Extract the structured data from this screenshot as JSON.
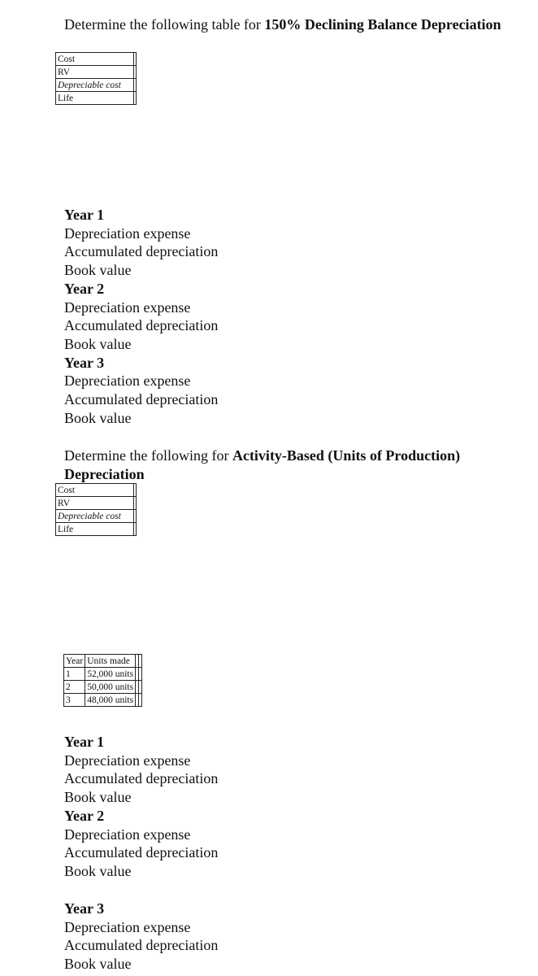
{
  "section1": {
    "heading_prefix": "Determine the following table for ",
    "heading_bold": "150% Declining Balance Depreciation",
    "table_rows": [
      {
        "label": "Cost",
        "value": ""
      },
      {
        "label": "RV",
        "value": ""
      },
      {
        "label": "Depreciable cost",
        "value": ""
      },
      {
        "label": "Life",
        "value": ""
      }
    ],
    "years": [
      {
        "title": "Year 1",
        "lines": [
          "Depreciation expense",
          "Accumulated depreciation",
          "Book value"
        ]
      },
      {
        "title": "Year 2",
        "lines": [
          "Depreciation expense",
          "Accumulated depreciation",
          "Book value"
        ]
      },
      {
        "title": "Year 3",
        "lines": [
          "Depreciation expense",
          "Accumulated depreciation",
          "Book value"
        ]
      }
    ]
  },
  "section2": {
    "heading_prefix": "Determine the following for ",
    "heading_bold": "Activity-Based (Units of Production) Depreciation",
    "table_rows": [
      {
        "label": "Cost",
        "value": ""
      },
      {
        "label": "RV",
        "value": ""
      },
      {
        "label": "Depreciable cost",
        "value": ""
      },
      {
        "label": "Life",
        "value": ""
      }
    ],
    "units_table": {
      "headers": [
        "Year",
        "Units made"
      ],
      "rows": [
        {
          "year": "1",
          "units": "52,000 units"
        },
        {
          "year": "2",
          "units": "50,000 units"
        },
        {
          "year": "3",
          "units": "48,000 units"
        }
      ]
    },
    "years": [
      {
        "title": "Year 1",
        "lines": [
          "Depreciation expense",
          "Accumulated depreciation",
          "Book value"
        ]
      },
      {
        "title": "Year 2",
        "lines": [
          "Depreciation expense",
          "Accumulated depreciation",
          "Book value"
        ]
      },
      {
        "title": "Year 3",
        "lines": [
          "Depreciation expense",
          "Accumulated depreciation",
          "Book value"
        ]
      }
    ]
  }
}
